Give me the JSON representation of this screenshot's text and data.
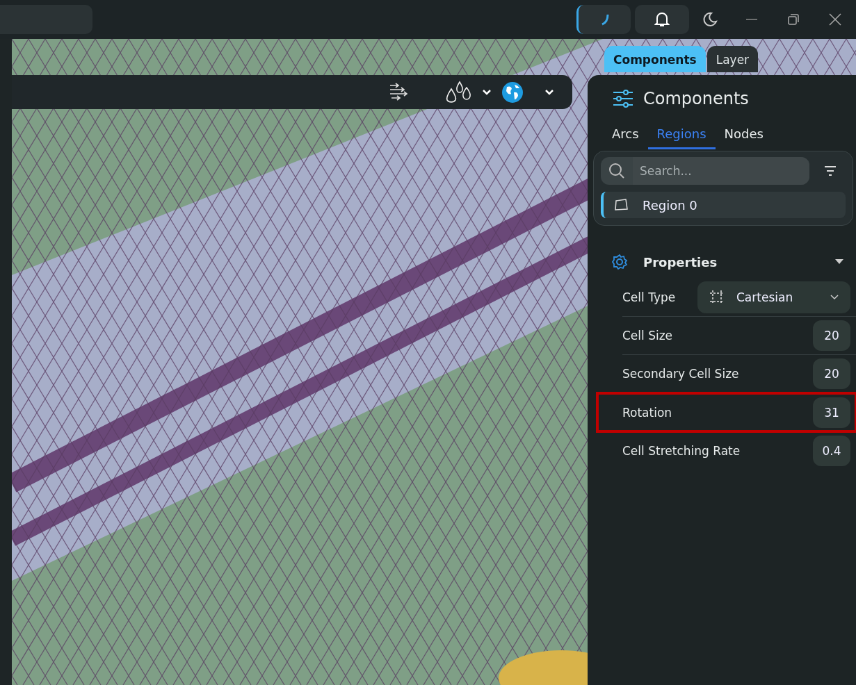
{
  "top_bar": {
    "sync_active": true
  },
  "panel_tabs": [
    {
      "label": "Components",
      "selected": true
    },
    {
      "label": "Layer",
      "selected": false
    }
  ],
  "panel": {
    "title": "Components",
    "tabs": [
      {
        "label": "Arcs",
        "selected": false
      },
      {
        "label": "Regions",
        "selected": true
      },
      {
        "label": "Nodes",
        "selected": false
      }
    ],
    "search": {
      "placeholder": "Search..."
    },
    "items": [
      {
        "label": "Region 0",
        "selected": true
      }
    ],
    "properties": {
      "title": "Properties",
      "expanded": true,
      "rows": [
        {
          "kind": "select",
          "label": "Cell Type",
          "value": "Cartesian",
          "highlighted": false
        },
        {
          "kind": "number",
          "label": "Cell Size",
          "value": "20",
          "highlighted": false
        },
        {
          "kind": "number",
          "label": "Secondary Cell Size",
          "value": "20",
          "highlighted": false
        },
        {
          "kind": "number",
          "label": "Rotation",
          "value": "31",
          "highlighted": true
        },
        {
          "kind": "number",
          "label": "Cell Stretching Rate",
          "value": "0.4",
          "highlighted": false
        }
      ]
    }
  }
}
